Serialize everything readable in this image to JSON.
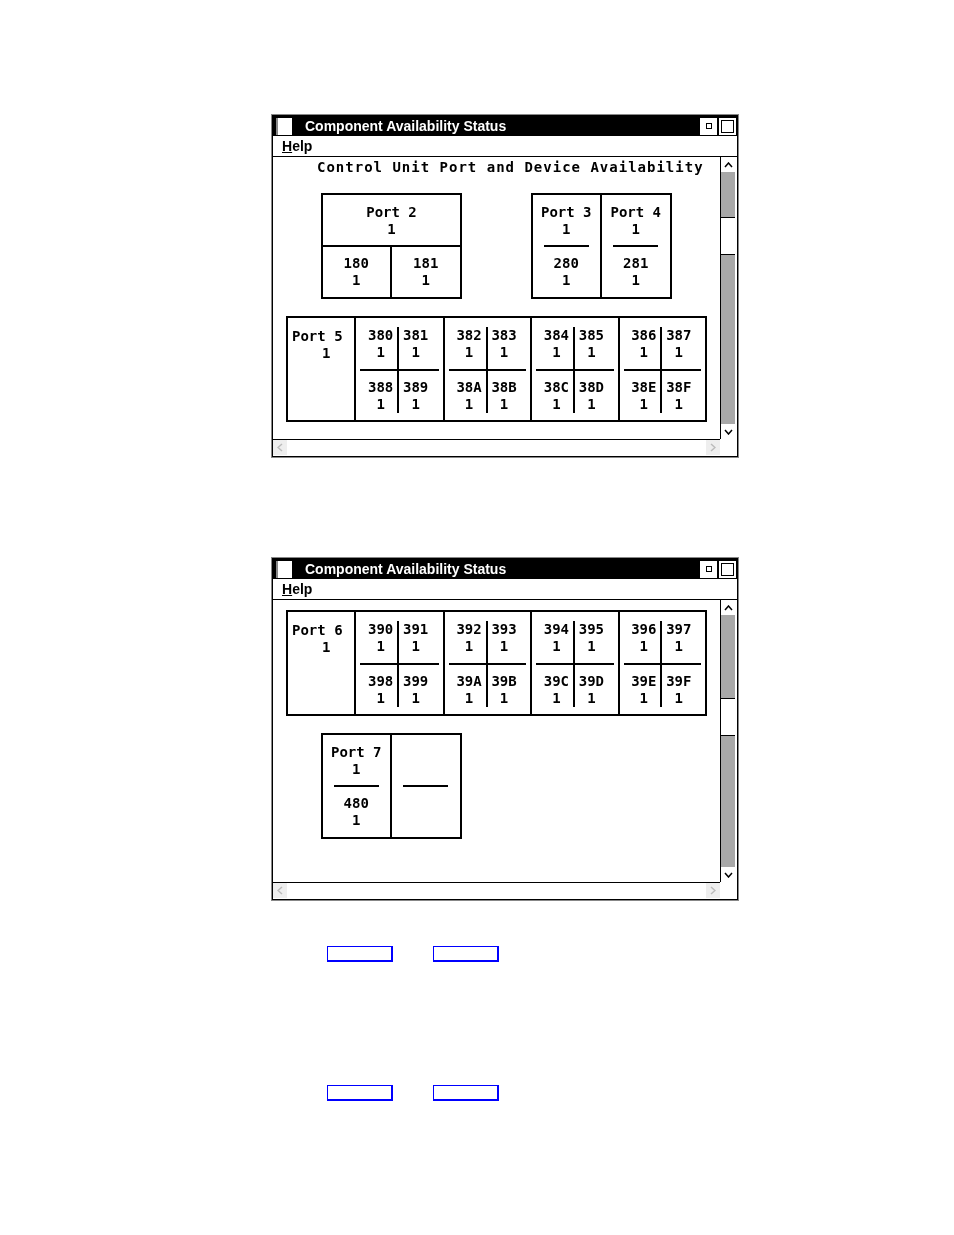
{
  "windows": [
    {
      "title": "Component Availability Status",
      "menu": [
        "Help"
      ],
      "heading": "Control Unit Port and Device Availability",
      "rows": [
        [
          {
            "kind": "split",
            "port": {
              "label": "Port 2",
              "status": "1"
            },
            "devices": [
              {
                "address": "180",
                "status": "1"
              },
              {
                "address": "181",
                "status": "1"
              }
            ]
          },
          {
            "kind": "pair",
            "columns": [
              {
                "kind": "port",
                "port": {
                  "label": "Port 3",
                  "status": "1"
                },
                "device": {
                  "address": "280",
                  "status": "1"
                }
              },
              {
                "kind": "port",
                "port": {
                  "label": "Port 4",
                  "status": "1"
                },
                "device": {
                  "address": "281",
                  "status": "1"
                }
              }
            ]
          }
        ],
        [
          {
            "kind": "grid",
            "port": {
              "label": "Port 5",
              "status": "1"
            },
            "groups": [
              {
                "devices": [
                  {
                    "address": "380",
                    "status": "1"
                  },
                  {
                    "address": "381",
                    "status": "1"
                  },
                  {
                    "address": "388",
                    "status": "1"
                  },
                  {
                    "address": "389",
                    "status": "1"
                  }
                ]
              },
              {
                "devices": [
                  {
                    "address": "382",
                    "status": "1"
                  },
                  {
                    "address": "383",
                    "status": "1"
                  },
                  {
                    "address": "38A",
                    "status": "1"
                  },
                  {
                    "address": "38B",
                    "status": "1"
                  }
                ]
              },
              {
                "devices": [
                  {
                    "address": "384",
                    "status": "1"
                  },
                  {
                    "address": "385",
                    "status": "1"
                  },
                  {
                    "address": "38C",
                    "status": "1"
                  },
                  {
                    "address": "38D",
                    "status": "1"
                  }
                ]
              },
              {
                "devices": [
                  {
                    "address": "386",
                    "status": "1"
                  },
                  {
                    "address": "387",
                    "status": "1"
                  },
                  {
                    "address": "38E",
                    "status": "1"
                  },
                  {
                    "address": "38F",
                    "status": "1"
                  }
                ]
              }
            ]
          }
        ]
      ]
    },
    {
      "title": "Component Availability Status",
      "menu": [
        "Help"
      ],
      "rows": [
        [
          {
            "kind": "grid",
            "port": {
              "label": "Port 6",
              "status": "1"
            },
            "groups": [
              {
                "devices": [
                  {
                    "address": "390",
                    "status": "1"
                  },
                  {
                    "address": "391",
                    "status": "1"
                  },
                  {
                    "address": "398",
                    "status": "1"
                  },
                  {
                    "address": "399",
                    "status": "1"
                  }
                ]
              },
              {
                "devices": [
                  {
                    "address": "392",
                    "status": "1"
                  },
                  {
                    "address": "393",
                    "status": "1"
                  },
                  {
                    "address": "39A",
                    "status": "1"
                  },
                  {
                    "address": "39B",
                    "status": "1"
                  }
                ]
              },
              {
                "devices": [
                  {
                    "address": "394",
                    "status": "1"
                  },
                  {
                    "address": "395",
                    "status": "1"
                  },
                  {
                    "address": "39C",
                    "status": "1"
                  },
                  {
                    "address": "39D",
                    "status": "1"
                  }
                ]
              },
              {
                "devices": [
                  {
                    "address": "396",
                    "status": "1"
                  },
                  {
                    "address": "397",
                    "status": "1"
                  },
                  {
                    "address": "39E",
                    "status": "1"
                  },
                  {
                    "address": "39F",
                    "status": "1"
                  }
                ]
              }
            ]
          }
        ],
        [
          {
            "kind": "pair",
            "columns": [
              {
                "kind": "port",
                "port": {
                  "label": "Port 7",
                  "status": "1"
                },
                "device": {
                  "address": "480",
                  "status": "1"
                }
              },
              {
                "kind": "empty"
              }
            ]
          }
        ]
      ]
    }
  ]
}
